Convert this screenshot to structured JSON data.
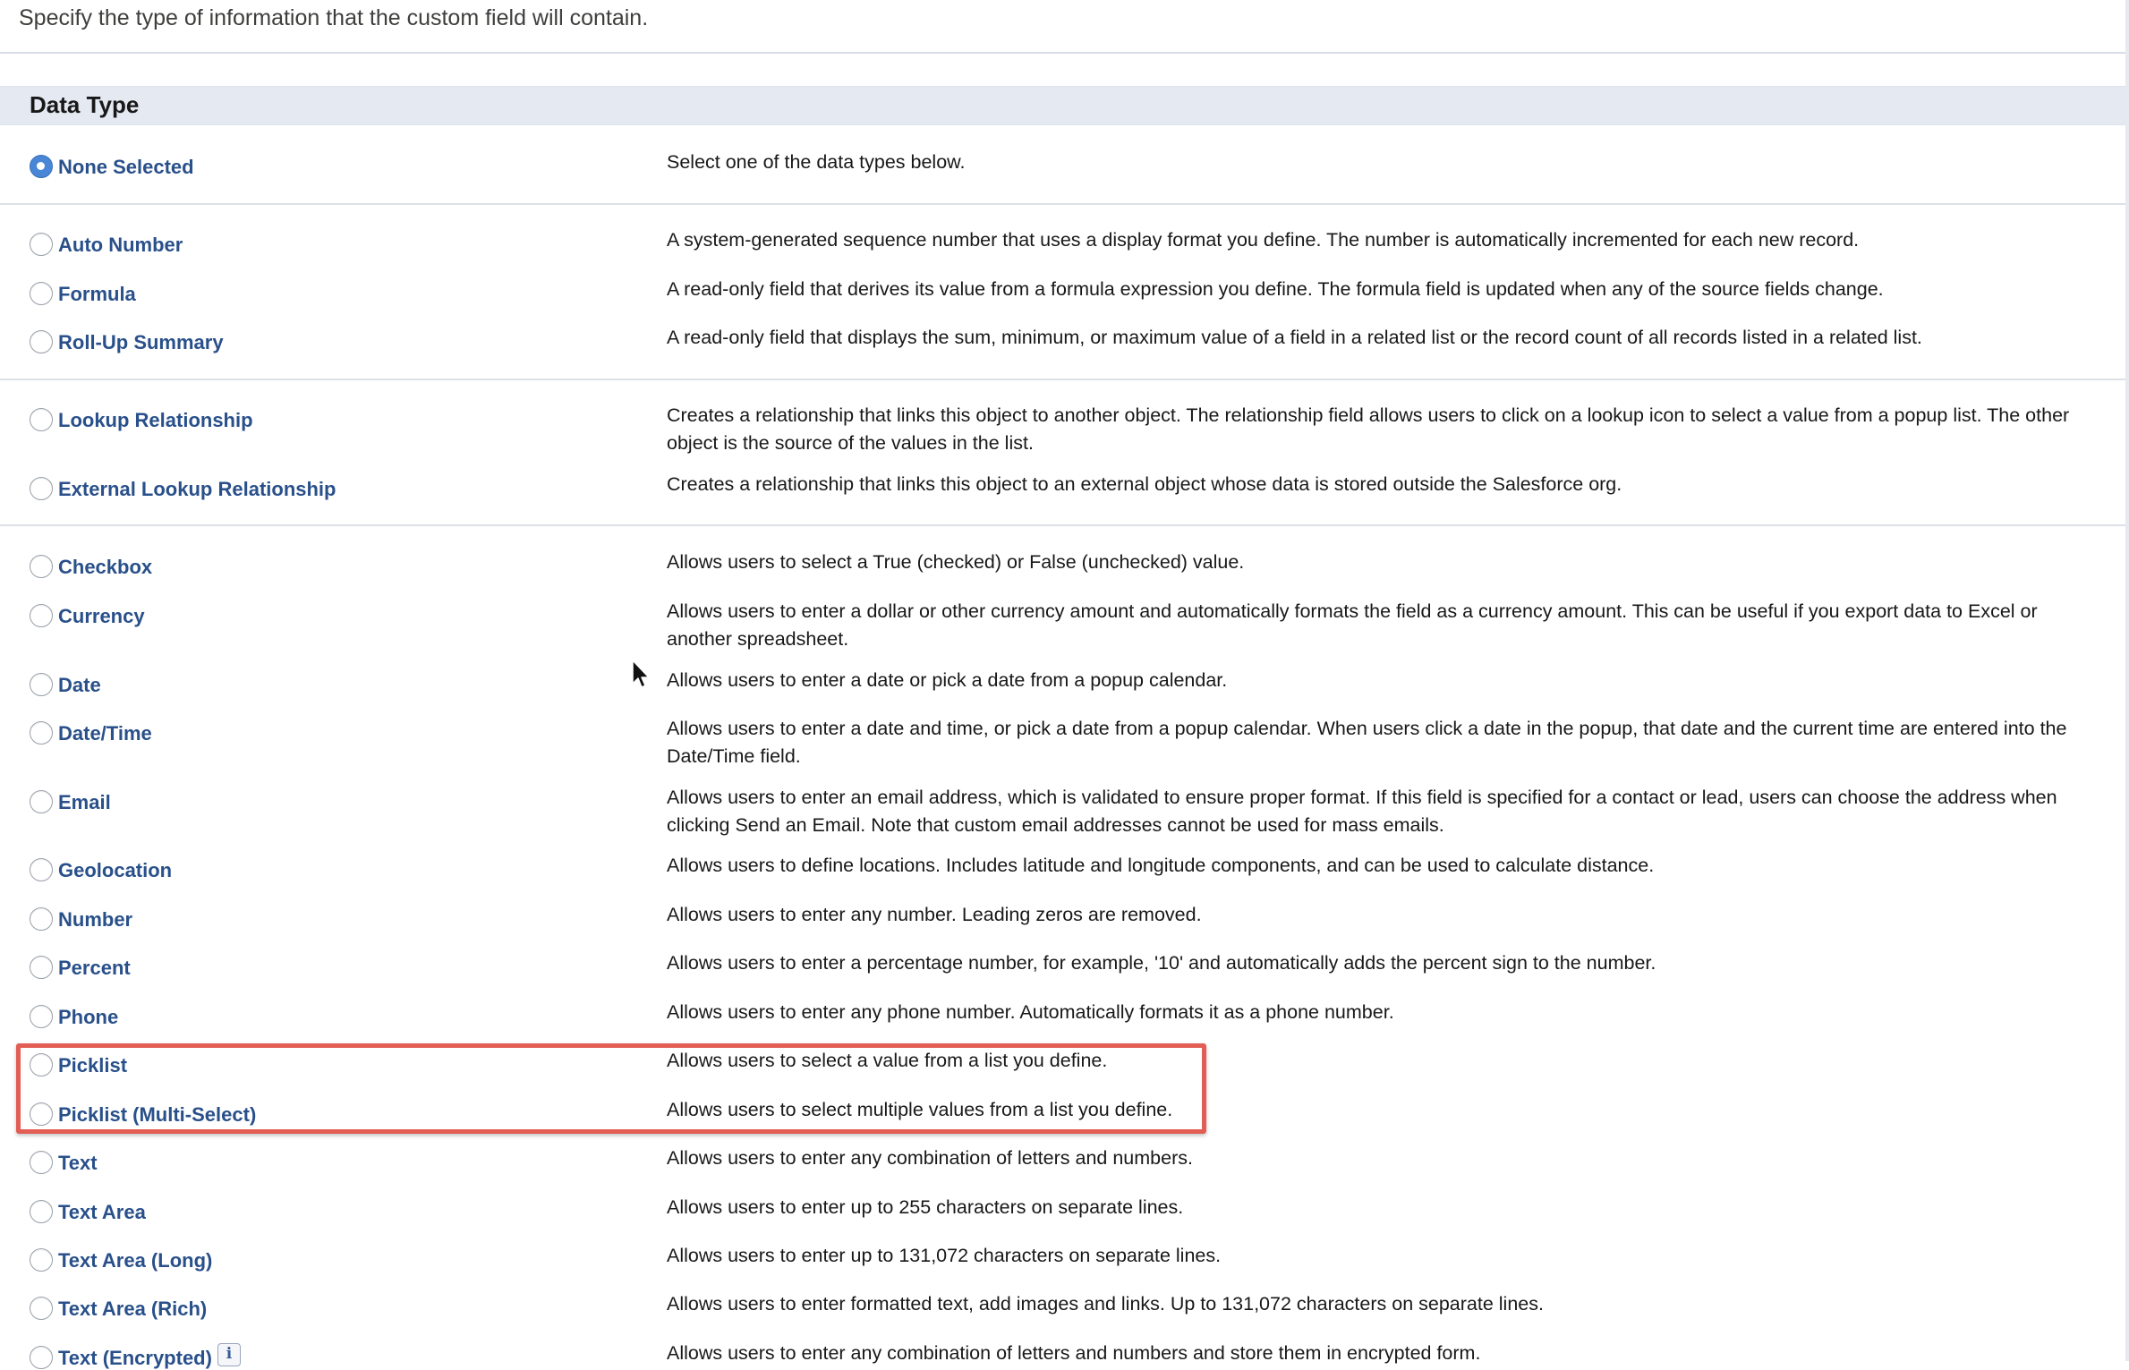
{
  "instructions": "Specify the type of information that the custom field will contain.",
  "section": {
    "title": "Data Type"
  },
  "options": {
    "none_selected": {
      "label": "None Selected",
      "description": "Select one of the data types below.",
      "checked": true
    },
    "auto_number": {
      "label": "Auto Number",
      "description": "A system-generated sequence number that uses a display format you define. The number is automatically incremented for each new record."
    },
    "formula": {
      "label": "Formula",
      "description": "A read-only field that derives its value from a formula expression you define. The formula field is updated when any of the source fields change."
    },
    "roll_up_summary": {
      "label": "Roll-Up Summary",
      "description": "A read-only field that displays the sum, minimum, or maximum value of a field in a related list or the record count of all records listed in a related list."
    },
    "lookup_relationship": {
      "label": "Lookup Relationship",
      "description": "Creates a relationship that links this object to another object. The relationship field allows users to click on a lookup icon to select a value from a popup list. The other object is the source of the values in the list."
    },
    "external_lookup_relationship": {
      "label": "External Lookup Relationship",
      "description": "Creates a relationship that links this object to an external object whose data is stored outside the Salesforce org."
    },
    "checkbox": {
      "label": "Checkbox",
      "description": "Allows users to select a True (checked) or False (unchecked) value."
    },
    "currency": {
      "label": "Currency",
      "description": "Allows users to enter a dollar or other currency amount and automatically formats the field as a currency amount. This can be useful if you export data to Excel or another spreadsheet."
    },
    "date": {
      "label": "Date",
      "description": "Allows users to enter a date or pick a date from a popup calendar."
    },
    "date_time": {
      "label": "Date/Time",
      "description": "Allows users to enter a date and time, or pick a date from a popup calendar. When users click a date in the popup, that date and the current time are entered into the Date/Time field."
    },
    "email": {
      "label": "Email",
      "description": "Allows users to enter an email address, which is validated to ensure proper format. If this field is specified for a contact or lead, users can choose the address when clicking Send an Email. Note that custom email addresses cannot be used for mass emails."
    },
    "geolocation": {
      "label": "Geolocation",
      "description": "Allows users to define locations. Includes latitude and longitude components, and can be used to calculate distance."
    },
    "number": {
      "label": "Number",
      "description": "Allows users to enter any number. Leading zeros are removed."
    },
    "percent": {
      "label": "Percent",
      "description": "Allows users to enter a percentage number, for example, '10' and automatically adds the percent sign to the number."
    },
    "phone": {
      "label": "Phone",
      "description": "Allows users to enter any phone number. Automatically formats it as a phone number."
    },
    "picklist": {
      "label": "Picklist",
      "description": "Allows users to select a value from a list you define."
    },
    "picklist_multi": {
      "label": "Picklist (Multi-Select)",
      "description": "Allows users to select multiple values from a list you define."
    },
    "text": {
      "label": "Text",
      "description": "Allows users to enter any combination of letters and numbers."
    },
    "text_area": {
      "label": "Text Area",
      "description": "Allows users to enter up to 255 characters on separate lines."
    },
    "text_area_long": {
      "label": "Text Area (Long)",
      "description": "Allows users to enter up to 131,072 characters on separate lines."
    },
    "text_area_rich": {
      "label": "Text Area (Rich)",
      "description": "Allows users to enter formatted text, add images and links. Up to 131,072 characters on separate lines."
    },
    "text_encrypted": {
      "label": "Text (Encrypted)",
      "description": "Allows users to enter any combination of letters and numbers and store them in encrypted form.",
      "info_icon": "i"
    }
  },
  "icons": {
    "info": "info-icon",
    "cursor": "mouse-pointer-icon"
  },
  "colors": {
    "label_link": "#29508a",
    "section_header_bg": "#e4e9f2",
    "radio_checked": "#4a86d6",
    "highlight": "#e25d54"
  }
}
